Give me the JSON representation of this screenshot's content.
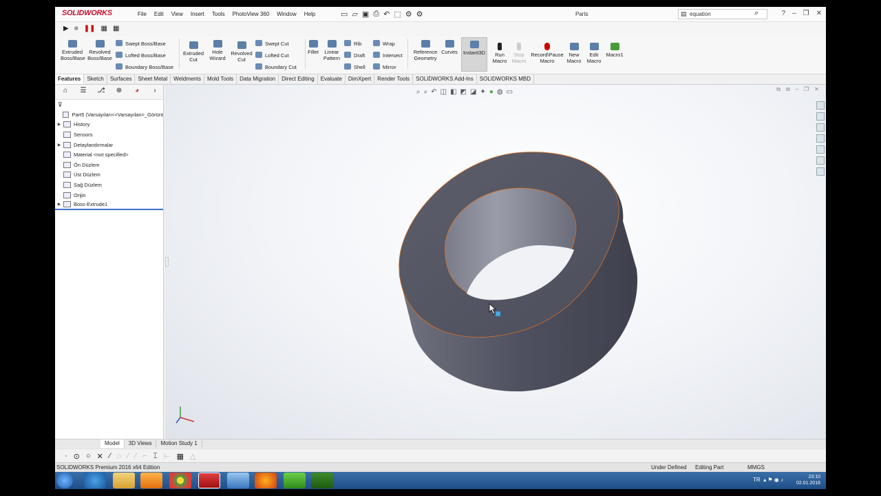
{
  "app": {
    "logo": "SOLIDWORKS",
    "menu": [
      "File",
      "Edit",
      "View",
      "Insert",
      "Tools",
      "PhotoView 360",
      "Window",
      "Help"
    ],
    "document_title": "Parts",
    "search_value": "equation"
  },
  "ribbon": {
    "extruded_boss": "Extruded Boss/Base",
    "revolved_boss": "Revolved Boss/Base",
    "swept_boss": "Swept Boss/Base",
    "lofted_boss": "Lofted Boss/Base",
    "boundary_boss": "Boundary Boss/Base",
    "extruded_cut": "Extruded Cut",
    "hole_wizard": "Hole Wizard",
    "revolved_cut": "Revolved Cut",
    "swept_cut": "Swept Cut",
    "lofted_cut": "Lofted Cut",
    "boundary_cut": "Boundary Cut",
    "fillet": "Fillet",
    "linear_pattern": "Linear Pattern",
    "rib": "Rib",
    "draft": "Draft",
    "shell": "Shell",
    "wrap": "Wrap",
    "intersect": "Intersect",
    "mirror": "Mirror",
    "reference_geometry": "Reference Geometry",
    "curves": "Curves",
    "instant3d": "Instant3D",
    "run_macro": "Run Macro",
    "stop_macro": "Stop Macro",
    "record_macro": "Record\\Pause Macro",
    "new_macro": "New Macro",
    "edit_macro": "Edit Macro",
    "macro1": "Macro1"
  },
  "command_tabs": [
    "Features",
    "Sketch",
    "Surfaces",
    "Sheet Metal",
    "Weldments",
    "Mold Tools",
    "Data Migration",
    "Direct Editing",
    "Evaluate",
    "DimXpert",
    "Render Tools",
    "SOLIDWORKS Add-Ins",
    "SOLIDWORKS MBD"
  ],
  "tree": {
    "root": "Part5  (Varsayılan<<Varsayılan>_Görünt",
    "items": [
      {
        "label": "History",
        "expandable": true
      },
      {
        "label": "Sensors",
        "expandable": false
      },
      {
        "label": "Detaylandırmalar",
        "expandable": true
      },
      {
        "label": "Material <not specified>",
        "expandable": false
      },
      {
        "label": "Ön Düzlem",
        "expandable": false
      },
      {
        "label": "Üst Düzlem",
        "expandable": false
      },
      {
        "label": "Sağ Düzlem",
        "expandable": false
      },
      {
        "label": "Orijin",
        "expandable": false
      },
      {
        "label": "Boss-Extrude1",
        "expandable": true
      }
    ]
  },
  "bottom_tabs": [
    "Model",
    "3D Views",
    "Motion Study 1"
  ],
  "status": {
    "edition": "SOLIDWORKS Premium 2016 x64 Edition",
    "state": "Under Defined",
    "mode": "Editing Part",
    "units": "MMGS"
  },
  "taskbar": {
    "language": "TR",
    "time": "23:10",
    "date": "02.01.2016"
  },
  "colors": {
    "part_body": "#5a5c6a",
    "edge_highlight": "#e07020",
    "brand": "#c8102e",
    "taskbar": "#2a5d96"
  }
}
